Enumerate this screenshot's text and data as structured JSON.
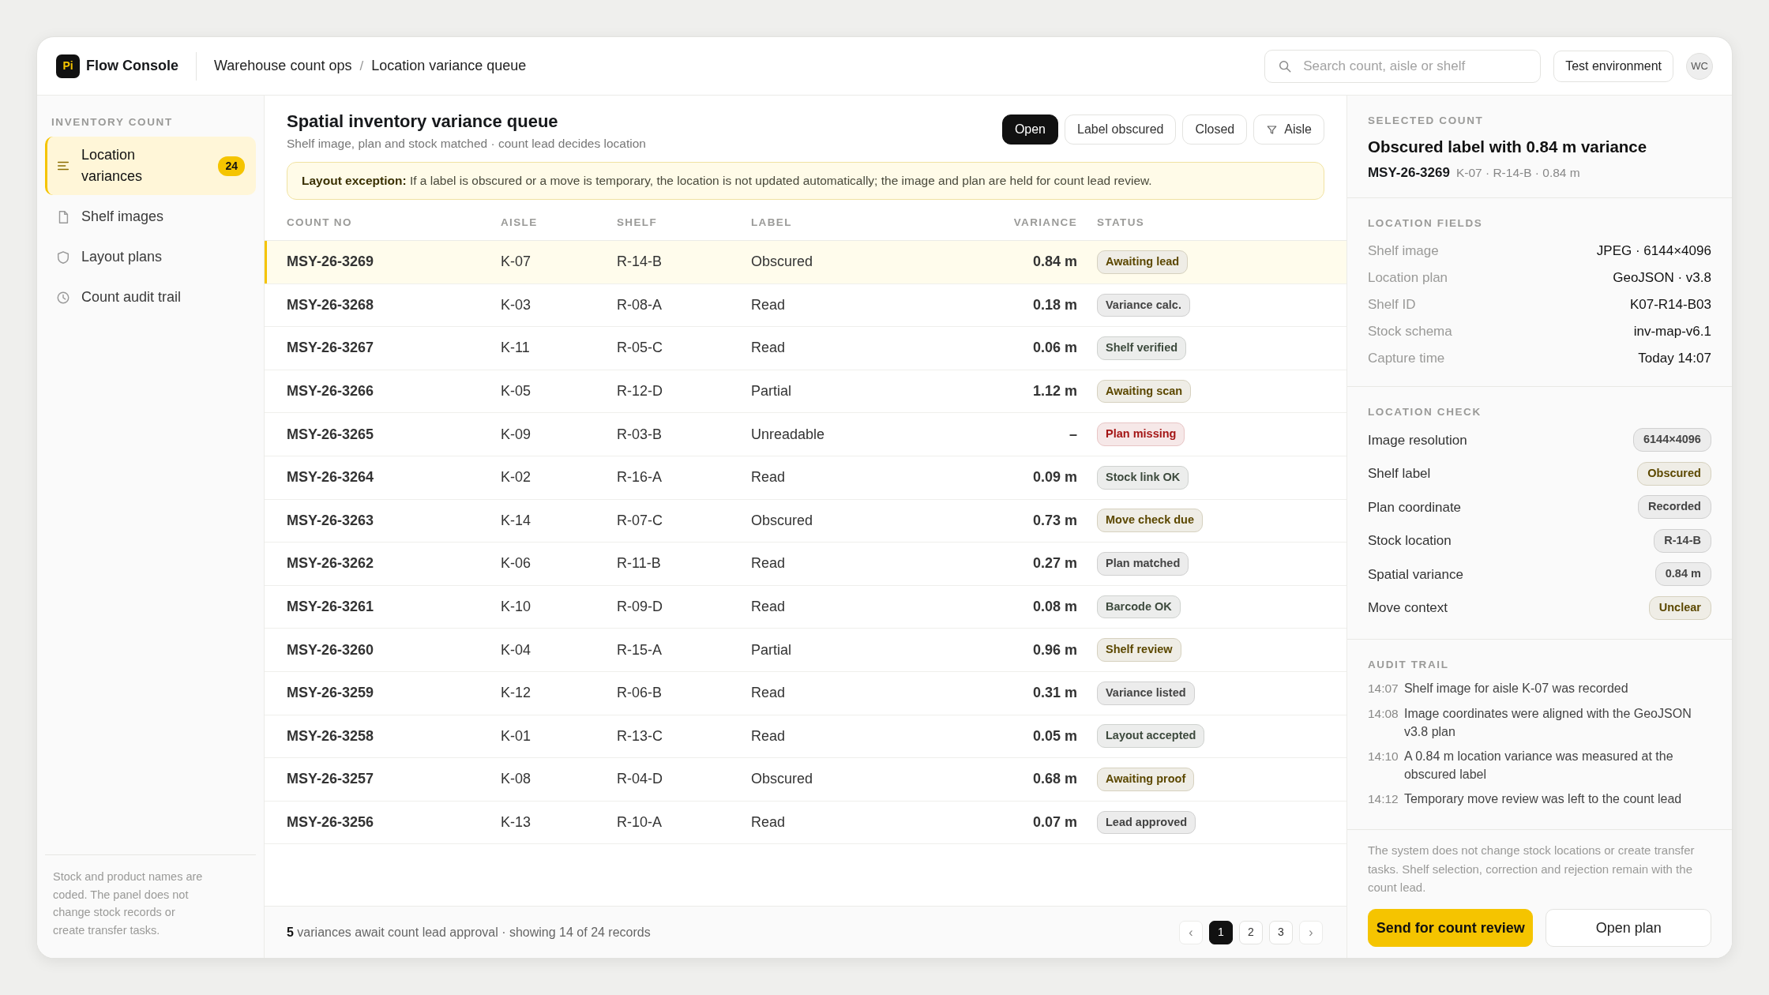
{
  "topbar": {
    "logo": "Pi",
    "app_name": "Flow Console",
    "breadcrumbs": [
      "Warehouse count ops",
      "Location variance queue"
    ],
    "separator": "/",
    "search": {
      "placeholder": "Search count, aisle or shelf"
    },
    "environment": "Test environment",
    "avatar": "WC"
  },
  "sidebar": {
    "section": "INVENTORY COUNT",
    "items": [
      {
        "label": "Location variances",
        "badge": "24",
        "selected": true
      },
      {
        "label": "Shelf images",
        "selected": false
      },
      {
        "label": "Layout plans",
        "selected": false
      },
      {
        "label": "Count audit trail",
        "selected": false
      }
    ],
    "note": "Stock and product names are coded. The panel does not change stock records or create transfer tasks."
  },
  "queue": {
    "title": "Spatial inventory variance queue",
    "subtitle": "Shelf image, plan and stock matched · count lead decides location",
    "filters": [
      {
        "label": "Open",
        "selected": true
      },
      {
        "label": "Label obscured",
        "selected": false
      },
      {
        "label": "Closed",
        "selected": false
      },
      {
        "label": "Aisle",
        "selected": false,
        "kind": "filter"
      }
    ],
    "alert": "**Layout exception:**  If a label is obscured or a move is temporary, the location is not updated automatically; the image and plan are held for count lead review.",
    "table": {
      "columns": [
        "COUNT NO",
        "AISLE",
        "SHELF",
        "LABEL",
        "VARIANCE",
        "STATUS"
      ],
      "rows": [
        {
          "count_no": "MSY-26-3269",
          "aisle": "K-07",
          "shelf": "R-14-B",
          "label": "Obscured",
          "variance": "0.84 m",
          "status": "Awaiting lead",
          "color": "#5c4800",
          "selected": true
        },
        {
          "count_no": "MSY-26-3268",
          "aisle": "K-03",
          "shelf": "R-08-A",
          "label": "Read",
          "variance": "0.18 m",
          "status": "Variance calc.",
          "color": "#444444",
          "selected": false
        },
        {
          "count_no": "MSY-26-3267",
          "aisle": "K-11",
          "shelf": "R-05-C",
          "label": "Read",
          "variance": "0.06 m",
          "status": "Shelf verified",
          "color": "#3d4a3d",
          "selected": false
        },
        {
          "count_no": "MSY-26-3266",
          "aisle": "K-05",
          "shelf": "R-12-D",
          "label": "Partial",
          "variance": "1.12 m",
          "status": "Awaiting scan",
          "color": "#5c4800",
          "selected": false
        },
        {
          "count_no": "MSY-26-3265",
          "aisle": "K-09",
          "shelf": "R-03-B",
          "label": "Unreadable",
          "variance": "–",
          "status": "Plan missing",
          "color": "#a41616",
          "selected": false
        },
        {
          "count_no": "MSY-26-3264",
          "aisle": "K-02",
          "shelf": "R-16-A",
          "label": "Read",
          "variance": "0.09 m",
          "status": "Stock link OK",
          "color": "#3d4a3d",
          "selected": false
        },
        {
          "count_no": "MSY-26-3263",
          "aisle": "K-14",
          "shelf": "R-07-C",
          "label": "Obscured",
          "variance": "0.73 m",
          "status": "Move check due",
          "color": "#5c4800",
          "selected": false
        },
        {
          "count_no": "MSY-26-3262",
          "aisle": "K-06",
          "shelf": "R-11-B",
          "label": "Read",
          "variance": "0.27 m",
          "status": "Plan matched",
          "color": "#444444",
          "selected": false
        },
        {
          "count_no": "MSY-26-3261",
          "aisle": "K-10",
          "shelf": "R-09-D",
          "label": "Read",
          "variance": "0.08 m",
          "status": "Barcode OK",
          "color": "#3d4a3d",
          "selected": false
        },
        {
          "count_no": "MSY-26-3260",
          "aisle": "K-04",
          "shelf": "R-15-A",
          "label": "Partial",
          "variance": "0.96 m",
          "status": "Shelf review",
          "color": "#5c4800",
          "selected": false
        },
        {
          "count_no": "MSY-26-3259",
          "aisle": "K-12",
          "shelf": "R-06-B",
          "label": "Read",
          "variance": "0.31 m",
          "status": "Variance listed",
          "color": "#444444",
          "selected": false
        },
        {
          "count_no": "MSY-26-3258",
          "aisle": "K-01",
          "shelf": "R-13-C",
          "label": "Read",
          "variance": "0.05 m",
          "status": "Layout accepted",
          "color": "#3d4a3d",
          "selected": false
        },
        {
          "count_no": "MSY-26-3257",
          "aisle": "K-08",
          "shelf": "R-04-D",
          "label": "Obscured",
          "variance": "0.68 m",
          "status": "Awaiting proof",
          "color": "#5c4800",
          "selected": false
        },
        {
          "count_no": "MSY-26-3256",
          "aisle": "K-13",
          "shelf": "R-10-A",
          "label": "Read",
          "variance": "0.07 m",
          "status": "Lead approved",
          "color": "#444444",
          "selected": false
        }
      ]
    },
    "footer": "**5** variances await count lead approval · showing 14 of 24 records",
    "pagination": [
      {
        "label": "‹",
        "kind": "arrow",
        "selected": false
      },
      {
        "label": "1",
        "kind": "page",
        "selected": true
      },
      {
        "label": "2",
        "kind": "page",
        "selected": false
      },
      {
        "label": "3",
        "kind": "page",
        "selected": false
      },
      {
        "label": "›",
        "kind": "arrow",
        "selected": false
      }
    ]
  },
  "detail": {
    "section": "SELECTED COUNT",
    "title": "Obscured label with 0.84 m variance",
    "count_no": "MSY-26-3269",
    "meta": "K-07 · R-14-B · 0.84 m",
    "fields_title": "LOCATION FIELDS",
    "fields": [
      {
        "label": "Shelf image",
        "value": "JPEG · 6144×4096"
      },
      {
        "label": "Location plan",
        "value": "GeoJSON · v3.8"
      },
      {
        "label": "Shelf ID",
        "value": "K07-R14-B03"
      },
      {
        "label": "Stock schema",
        "value": "inv-map-v6.1"
      },
      {
        "label": "Capture time",
        "value": "Today 14:07"
      }
    ],
    "check_title": "LOCATION CHECK",
    "checks": [
      {
        "label": "Image resolution",
        "value": "6144×4096",
        "color": "#444444"
      },
      {
        "label": "Shelf label",
        "value": "Obscured",
        "color": "#5c4800"
      },
      {
        "label": "Plan coordinate",
        "value": "Recorded",
        "color": "#444444"
      },
      {
        "label": "Stock location",
        "value": "R-14-B",
        "color": "#444444"
      },
      {
        "label": "Spatial variance",
        "value": "0.84 m",
        "color": "#444444"
      },
      {
        "label": "Move context",
        "value": "Unclear",
        "color": "#5c4800"
      }
    ],
    "audit_title": "AUDIT TRAIL",
    "audit": [
      {
        "time": "14:07",
        "text": "Shelf image for aisle K-07 was recorded"
      },
      {
        "time": "14:08",
        "text": "Image coordinates were aligned with the GeoJSON v3.8 plan"
      },
      {
        "time": "14:10",
        "text": "A 0.84 m location variance was measured at the obscured label"
      },
      {
        "time": "14:12",
        "text": "Temporary move review was left to the count lead"
      }
    ],
    "note": "The system does not change stock locations or create transfer tasks. Shelf selection, correction and rejection remain with the count lead.",
    "actions": [
      {
        "label": "Send for count review",
        "kind": "primary"
      },
      {
        "label": "Open plan",
        "kind": "secondary"
      }
    ]
  }
}
